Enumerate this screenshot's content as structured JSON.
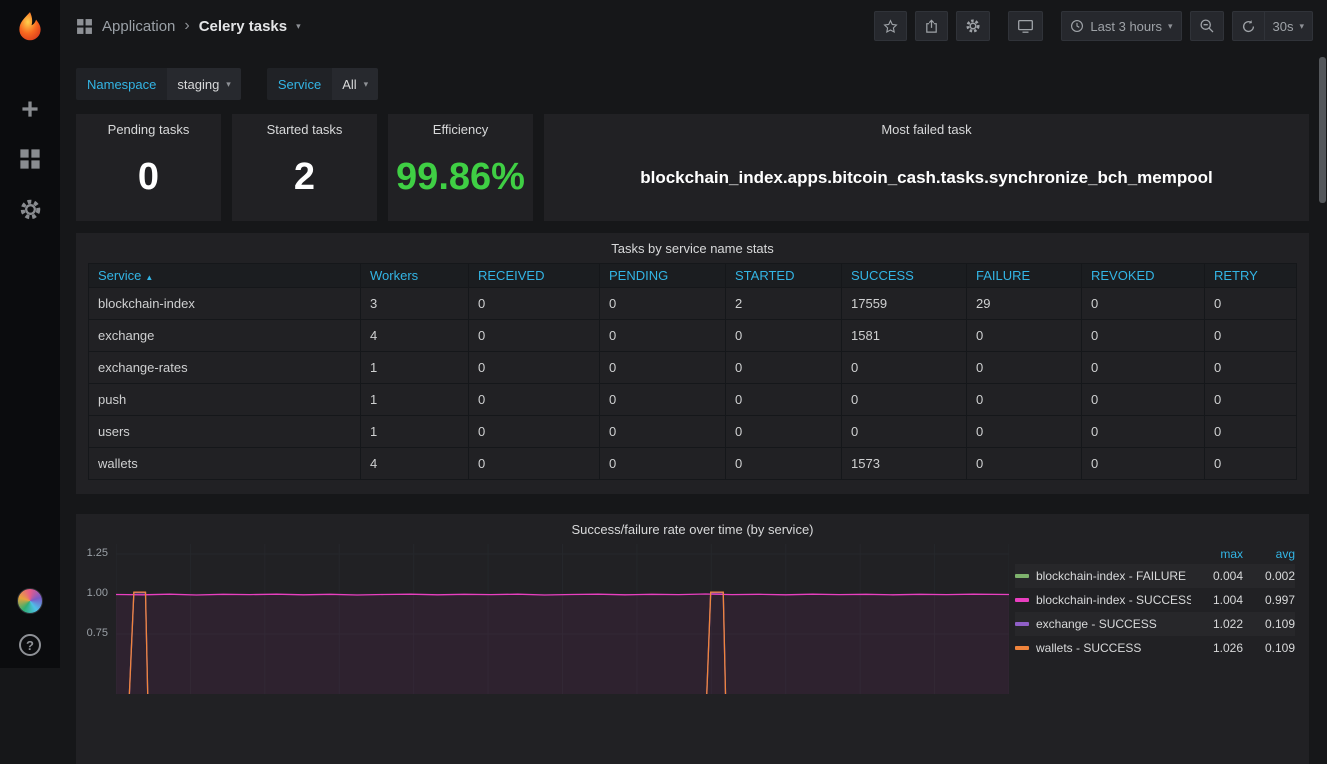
{
  "nav": {
    "breadcrumb_section": "Application",
    "breadcrumb_page": "Celery tasks",
    "time_range": "Last 3 hours",
    "refresh_interval": "30s"
  },
  "glyphs": {
    "caret_down": "▾",
    "chevron_right": "›",
    "sort_asc": "▲",
    "help": "?"
  },
  "icons": [
    "grafana-logo",
    "create-plus-icon",
    "dashboards-grid-icon",
    "settings-gear-icon",
    "user-avatar",
    "help-icon",
    "apps-grid-icon",
    "star-icon",
    "share-icon",
    "gear-icon",
    "tv-mode-icon",
    "clock-icon",
    "zoom-out-icon",
    "refresh-icon"
  ],
  "colors": {
    "accent_blue": "#33b5e5",
    "efficiency_green": "#3fcf44",
    "panel_bg": "#212124",
    "page_bg": "#161719"
  },
  "filters": [
    {
      "label": "Namespace",
      "value": "staging"
    },
    {
      "label": "Service",
      "value": "All"
    }
  ],
  "stats": [
    {
      "title": "Pending tasks",
      "value": "0",
      "color": "#ffffff"
    },
    {
      "title": "Started tasks",
      "value": "2",
      "color": "#ffffff"
    },
    {
      "title": "Efficiency",
      "value": "99.86%",
      "color": "#3fcf44"
    },
    {
      "title": "Most failed task",
      "value": "blockchain_index.apps.bitcoin_cash.tasks.synchronize_bch_mempool",
      "color": "#ffffff"
    }
  ],
  "table": {
    "title": "Tasks by service name stats",
    "columns": [
      "Service",
      "Workers",
      "RECEIVED",
      "PENDING",
      "STARTED",
      "SUCCESS",
      "FAILURE",
      "REVOKED",
      "RETRY"
    ],
    "sorted_column": "Service",
    "sort_order": "asc",
    "rows": [
      [
        "blockchain-index",
        "3",
        "0",
        "0",
        "2",
        "17559",
        "29",
        "0",
        "0"
      ],
      [
        "exchange",
        "4",
        "0",
        "0",
        "0",
        "1581",
        "0",
        "0",
        "0"
      ],
      [
        "exchange-rates",
        "1",
        "0",
        "0",
        "0",
        "0",
        "0",
        "0",
        "0"
      ],
      [
        "push",
        "1",
        "0",
        "0",
        "0",
        "0",
        "0",
        "0",
        "0"
      ],
      [
        "users",
        "1",
        "0",
        "0",
        "0",
        "0",
        "0",
        "0",
        "0"
      ],
      [
        "wallets",
        "4",
        "0",
        "0",
        "0",
        "1573",
        "0",
        "0",
        "0"
      ]
    ]
  },
  "chart": {
    "title": "Success/failure rate over time (by service)",
    "legend_headers": [
      "max",
      "avg"
    ],
    "chart_data": {
      "type": "line",
      "title": "Success/failure rate over time (by service)",
      "x_range_label": "Last 3 hours",
      "yticks": [
        "1.25",
        "1.00",
        "0.75"
      ],
      "grid": true,
      "legend_position": "right-table",
      "series": [
        {
          "name": "blockchain-index - FAILURE",
          "color": "#7eb26d",
          "max": "0.004",
          "avg": "0.002",
          "points": [
            [
              0,
              0.002
            ],
            [
              1,
              0.002
            ]
          ]
        },
        {
          "name": "blockchain-index - SUCCESS",
          "color": "#e93fc0",
          "max": "1.004",
          "avg": "0.997",
          "fill": "rgba(233,63,192,0.07)",
          "points": [
            [
              0,
              0.997
            ],
            [
              0.03,
              0.995
            ],
            [
              0.06,
              0.999
            ],
            [
              0.09,
              0.994
            ],
            [
              0.12,
              0.998
            ],
            [
              0.15,
              0.996
            ],
            [
              0.18,
              0.999
            ],
            [
              0.21,
              0.995
            ],
            [
              0.24,
              0.998
            ],
            [
              0.27,
              0.994
            ],
            [
              0.3,
              0.997
            ],
            [
              0.33,
              0.999
            ],
            [
              0.36,
              0.995
            ],
            [
              0.39,
              0.998
            ],
            [
              0.42,
              0.996
            ],
            [
              0.45,
              0.999
            ],
            [
              0.48,
              0.994
            ],
            [
              0.51,
              0.997
            ],
            [
              0.54,
              0.999
            ],
            [
              0.57,
              0.995
            ],
            [
              0.6,
              0.998
            ],
            [
              0.63,
              0.996
            ],
            [
              0.66,
              1.0
            ],
            [
              0.69,
              0.996
            ],
            [
              0.72,
              0.998
            ],
            [
              0.75,
              0.995
            ],
            [
              0.78,
              0.999
            ],
            [
              0.81,
              0.996
            ],
            [
              0.84,
              0.998
            ],
            [
              0.87,
              0.995
            ],
            [
              0.9,
              0.998
            ],
            [
              0.93,
              0.996
            ],
            [
              0.96,
              0.999
            ],
            [
              1,
              0.997
            ]
          ]
        },
        {
          "name": "exchange - SUCCESS",
          "color": "#8f5fc7",
          "max": "1.022",
          "avg": "0.109",
          "points": [
            [
              0,
              0
            ],
            [
              0.012,
              0
            ],
            [
              0.02,
              1.008
            ],
            [
              0.033,
              1.008
            ],
            [
              0.037,
              0
            ],
            [
              0.659,
              0
            ],
            [
              0.666,
              1.008
            ],
            [
              0.68,
              1.008
            ],
            [
              0.684,
              0
            ],
            [
              1,
              0
            ]
          ]
        },
        {
          "name": "wallets - SUCCESS",
          "color": "#ef843c",
          "max": "1.026",
          "avg": "0.109",
          "points": [
            [
              0,
              0
            ],
            [
              0.012,
              0
            ],
            [
              0.02,
              1.012
            ],
            [
              0.033,
              1.012
            ],
            [
              0.037,
              0
            ],
            [
              0.659,
              0
            ],
            [
              0.666,
              1.012
            ],
            [
              0.68,
              1.012
            ],
            [
              0.684,
              0
            ],
            [
              1,
              0
            ]
          ]
        }
      ]
    }
  }
}
